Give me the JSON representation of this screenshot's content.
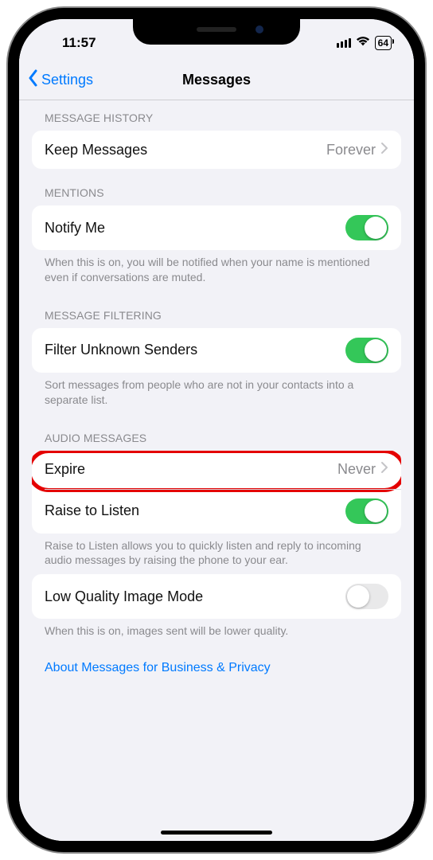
{
  "status": {
    "time": "11:57",
    "battery": "64"
  },
  "nav": {
    "back": "Settings",
    "title": "Messages"
  },
  "sections": {
    "history": {
      "header": "MESSAGE HISTORY",
      "keep_label": "Keep Messages",
      "keep_value": "Forever"
    },
    "mentions": {
      "header": "MENTIONS",
      "notify_label": "Notify Me",
      "notify_on": true,
      "footer": "When this is on, you will be notified when your name is mentioned even if conversations are muted."
    },
    "filtering": {
      "header": "MESSAGE FILTERING",
      "filter_label": "Filter Unknown Senders",
      "filter_on": true,
      "footer": "Sort messages from people who are not in your contacts into a separate list."
    },
    "audio": {
      "header": "AUDIO MESSAGES",
      "expire_label": "Expire",
      "expire_value": "Never",
      "raise_label": "Raise to Listen",
      "raise_on": true,
      "footer": "Raise to Listen allows you to quickly listen and reply to incoming audio messages by raising the phone to your ear."
    },
    "quality": {
      "low_label": "Low Quality Image Mode",
      "low_on": false,
      "footer": "When this is on, images sent will be lower quality."
    },
    "about_link": "About Messages for Business & Privacy"
  }
}
